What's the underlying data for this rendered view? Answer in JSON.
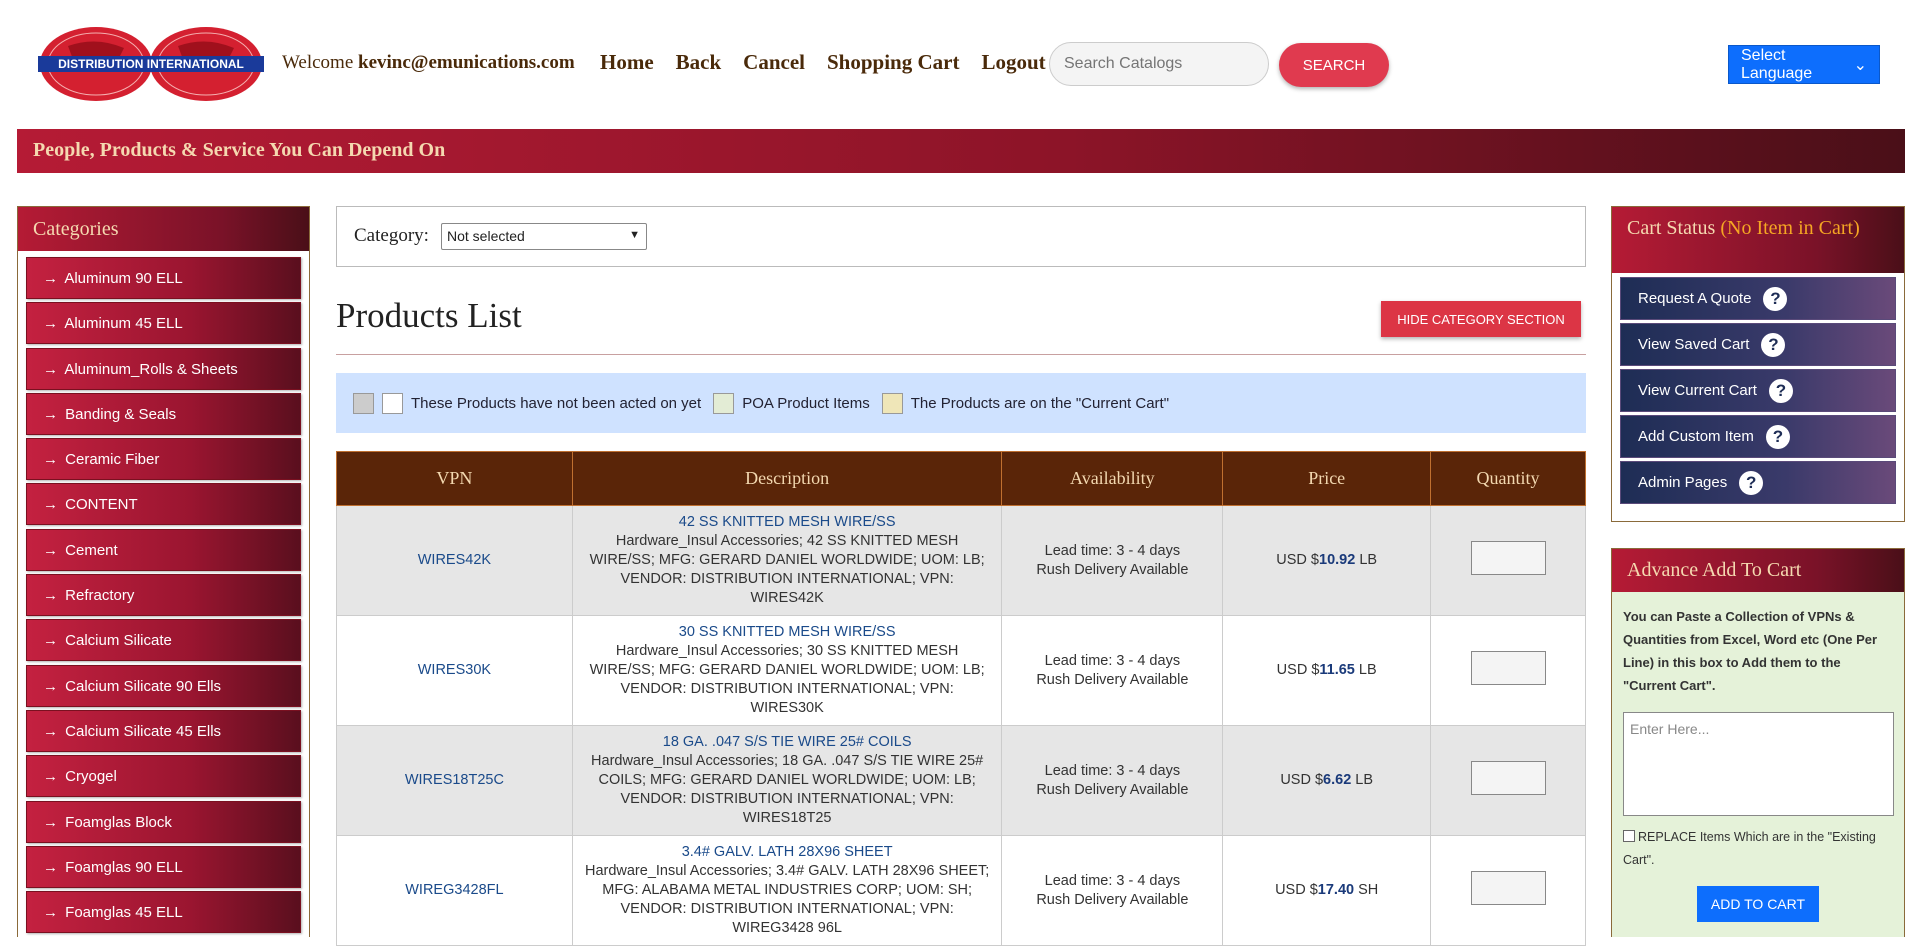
{
  "header": {
    "logo_text": "DISTRIBUTION INTERNATIONAL",
    "welcome_label": "Welcome",
    "user_email": "kevinc@emunications.com",
    "nav": [
      "Home",
      "Back",
      "Cancel",
      "Shopping Cart",
      "Logout"
    ],
    "search_placeholder": "Search Catalogs",
    "search_button": "SEARCH",
    "language_select": "Select Language"
  },
  "banner": "People, Products & Service You Can Depend On",
  "categories": {
    "title": "Categories",
    "items": [
      "Aluminum 90 ELL",
      "Aluminum 45 ELL",
      "Aluminum_Rolls & Sheets",
      "Banding & Seals",
      "Ceramic Fiber",
      "CONTENT",
      "Cement",
      "Refractory",
      "Calcium Silicate",
      "Calcium Silicate 90 Ells",
      "Calcium Silicate 45 Ells",
      "Cryogel",
      "Foamglas Block",
      "Foamglas 90 ELL",
      "Foamglas 45 ELL"
    ]
  },
  "category_filter": {
    "label": "Category:",
    "selected": "Not selected"
  },
  "products": {
    "title": "Products List",
    "hide_button": "HIDE CATEGORY SECTION",
    "legend": {
      "not_acted": "These Products have not been acted on yet",
      "poa": "POA Product Items",
      "current_cart": "The Products are on the \"Current Cart\""
    },
    "columns": [
      "VPN",
      "Description",
      "Availability",
      "Price",
      "Quantity"
    ],
    "rows": [
      {
        "vpn": "WIRES42K",
        "title": "42 SS KNITTED MESH WIRE/SS",
        "desc": "Hardware_Insul Accessories; 42 SS KNITTED MESH WIRE/SS; MFG: GERARD DANIEL WORLDWIDE; UOM: LB; VENDOR: DISTRIBUTION INTERNATIONAL; VPN: WIRES42K",
        "lead": "Lead time: 3 - 4 days",
        "rush": "Rush Delivery Available",
        "currency": "USD $",
        "price": "10.92",
        "uom": "LB"
      },
      {
        "vpn": "WIRES30K",
        "title": "30 SS KNITTED MESH WIRE/SS",
        "desc": "Hardware_Insul Accessories; 30 SS KNITTED MESH WIRE/SS; MFG: GERARD DANIEL WORLDWIDE; UOM: LB; VENDOR: DISTRIBUTION INTERNATIONAL; VPN: WIRES30K",
        "lead": "Lead time: 3 - 4 days",
        "rush": "Rush Delivery Available",
        "currency": "USD $",
        "price": "11.65",
        "uom": "LB"
      },
      {
        "vpn": "WIRES18T25C",
        "title": "18 GA. .047 S/S TIE WIRE 25# COILS",
        "desc": "Hardware_Insul Accessories; 18 GA. .047 S/S TIE WIRE 25# COILS; MFG: GERARD DANIEL WORLDWIDE; UOM: LB; VENDOR: DISTRIBUTION INTERNATIONAL; VPN: WIRES18T25",
        "lead": "Lead time: 3 - 4 days",
        "rush": "Rush Delivery Available",
        "currency": "USD $",
        "price": "6.62",
        "uom": "LB"
      },
      {
        "vpn": "WIREG3428FL",
        "title": "3.4# GALV. LATH 28X96 SHEET",
        "desc": "Hardware_Insul Accessories; 3.4# GALV. LATH 28X96 SHEET; MFG: ALABAMA METAL INDUSTRIES CORP; UOM: SH; VENDOR: DISTRIBUTION INTERNATIONAL; VPN: WIREG3428 96L",
        "lead": "Lead time: 3 - 4 days",
        "rush": "Rush Delivery Available",
        "currency": "USD $",
        "price": "17.40",
        "uom": "SH"
      }
    ]
  },
  "cart_status": {
    "title": "Cart Status",
    "status": "(No Item in Cart)",
    "buttons": [
      "Request A Quote",
      "View Saved Cart",
      "View Current Cart",
      "Add Custom Item",
      "Admin Pages"
    ]
  },
  "advance_add": {
    "title": "Advance Add To Cart",
    "instructions": "You can Paste a Collection of VPNs & Quantities from Excel, Word etc (One Per Line) in this box to Add them to the \"Current Cart\".",
    "placeholder": "Enter Here...",
    "replace_label": "REPLACE Items Which are in the \"Existing Cart\".",
    "add_button": "ADD TO CART"
  },
  "colors": {
    "brand_red": "#b51b35",
    "table_header": "#5a2508",
    "accent_blue": "#0d6efd",
    "search_red": "#e03a4f"
  }
}
